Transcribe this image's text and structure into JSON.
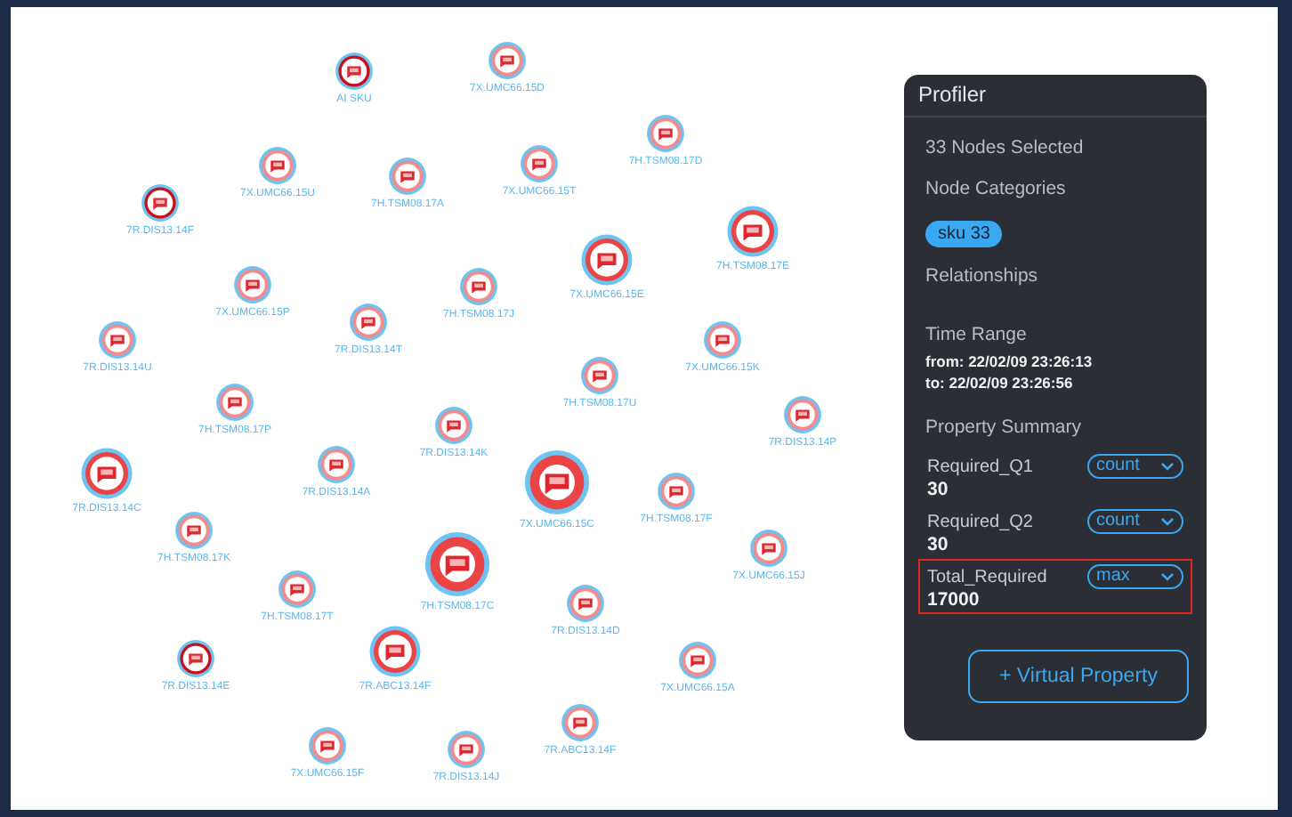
{
  "graph": {
    "nodes": [
      {
        "label": "AI SKU",
        "kind": "small",
        "emphasized": true
      },
      {
        "label": "7X.UMC66.15D",
        "kind": "small",
        "emphasized": false
      },
      {
        "label": "7H.TSM08.17D",
        "kind": "small",
        "emphasized": false
      },
      {
        "label": "7X.UMC66.15U",
        "kind": "small",
        "emphasized": false
      },
      {
        "label": "7H.TSM08.17A",
        "kind": "small",
        "emphasized": false
      },
      {
        "label": "7X.UMC66.15T",
        "kind": "small",
        "emphasized": false
      },
      {
        "label": "7R.DIS13.14F",
        "kind": "small",
        "emphasized": true
      },
      {
        "label": "7H.TSM08.17E",
        "kind": "medium",
        "emphasized": false
      },
      {
        "label": "7X.UMC66.15E",
        "kind": "medium",
        "emphasized": false
      },
      {
        "label": "7X.UMC66.15P",
        "kind": "small",
        "emphasized": false
      },
      {
        "label": "7H.TSM08.17J",
        "kind": "small",
        "emphasized": false
      },
      {
        "label": "7R.DIS13.14T",
        "kind": "small",
        "emphasized": false
      },
      {
        "label": "7R.DIS13.14U",
        "kind": "small",
        "emphasized": false
      },
      {
        "label": "7X.UMC66.15K",
        "kind": "small",
        "emphasized": false
      },
      {
        "label": "7H.TSM08.17U",
        "kind": "small",
        "emphasized": false
      },
      {
        "label": "7R.DIS13.14P",
        "kind": "small",
        "emphasized": false
      },
      {
        "label": "7H.TSM08.17P",
        "kind": "small",
        "emphasized": false
      },
      {
        "label": "7R.DIS13.14K",
        "kind": "small",
        "emphasized": false
      },
      {
        "label": "7R.DIS13.14C",
        "kind": "medium",
        "emphasized": false
      },
      {
        "label": "7R.DIS13.14A",
        "kind": "small",
        "emphasized": false
      },
      {
        "label": "7X.UMC66.15C",
        "kind": "large",
        "emphasized": false
      },
      {
        "label": "7H.TSM08.17F",
        "kind": "small",
        "emphasized": false
      },
      {
        "label": "7H.TSM08.17K",
        "kind": "small",
        "emphasized": false
      },
      {
        "label": "7X.UMC66.15J",
        "kind": "small",
        "emphasized": false
      },
      {
        "label": "7H.TSM08.17T",
        "kind": "small",
        "emphasized": false
      },
      {
        "label": "7H.TSM08.17C",
        "kind": "large",
        "emphasized": false
      },
      {
        "label": "7R.DIS13.14D",
        "kind": "small",
        "emphasized": false
      },
      {
        "label": "7R.DIS13.14E",
        "kind": "small",
        "emphasized": true
      },
      {
        "label": "7R.ABC13.14F",
        "kind": "medium",
        "emphasized": false
      },
      {
        "label": "7X.UMC66.15A",
        "kind": "small",
        "emphasized": false
      },
      {
        "label": "7X.UMC66.15F",
        "kind": "small",
        "emphasized": false
      },
      {
        "label": "7R.DIS13.14J",
        "kind": "small",
        "emphasized": false
      },
      {
        "label": "7R.ABC13.14F",
        "kind": "small",
        "emphasized": false
      }
    ]
  },
  "profiler": {
    "title": "Profiler",
    "selected_count": "33 Nodes Selected",
    "categories_heading": "Node Categories",
    "categories": [
      {
        "label": "sku 33"
      }
    ],
    "relationships_heading": "Relationships",
    "time_heading": "Time Range",
    "time_from": "from: 22/02/09 23:26:13",
    "time_to": "to: 22/02/09 23:26:56",
    "summary_heading": "Property Summary",
    "properties": [
      {
        "name": "Required_Q1",
        "aggregate": "count",
        "value": "30",
        "highlighted": false
      },
      {
        "name": "Required_Q2",
        "aggregate": "count",
        "value": "30",
        "highlighted": false
      },
      {
        "name": "Total_Required",
        "aggregate": "max",
        "value": "17000",
        "highlighted": true
      }
    ],
    "button": "+ Virtual Property"
  }
}
